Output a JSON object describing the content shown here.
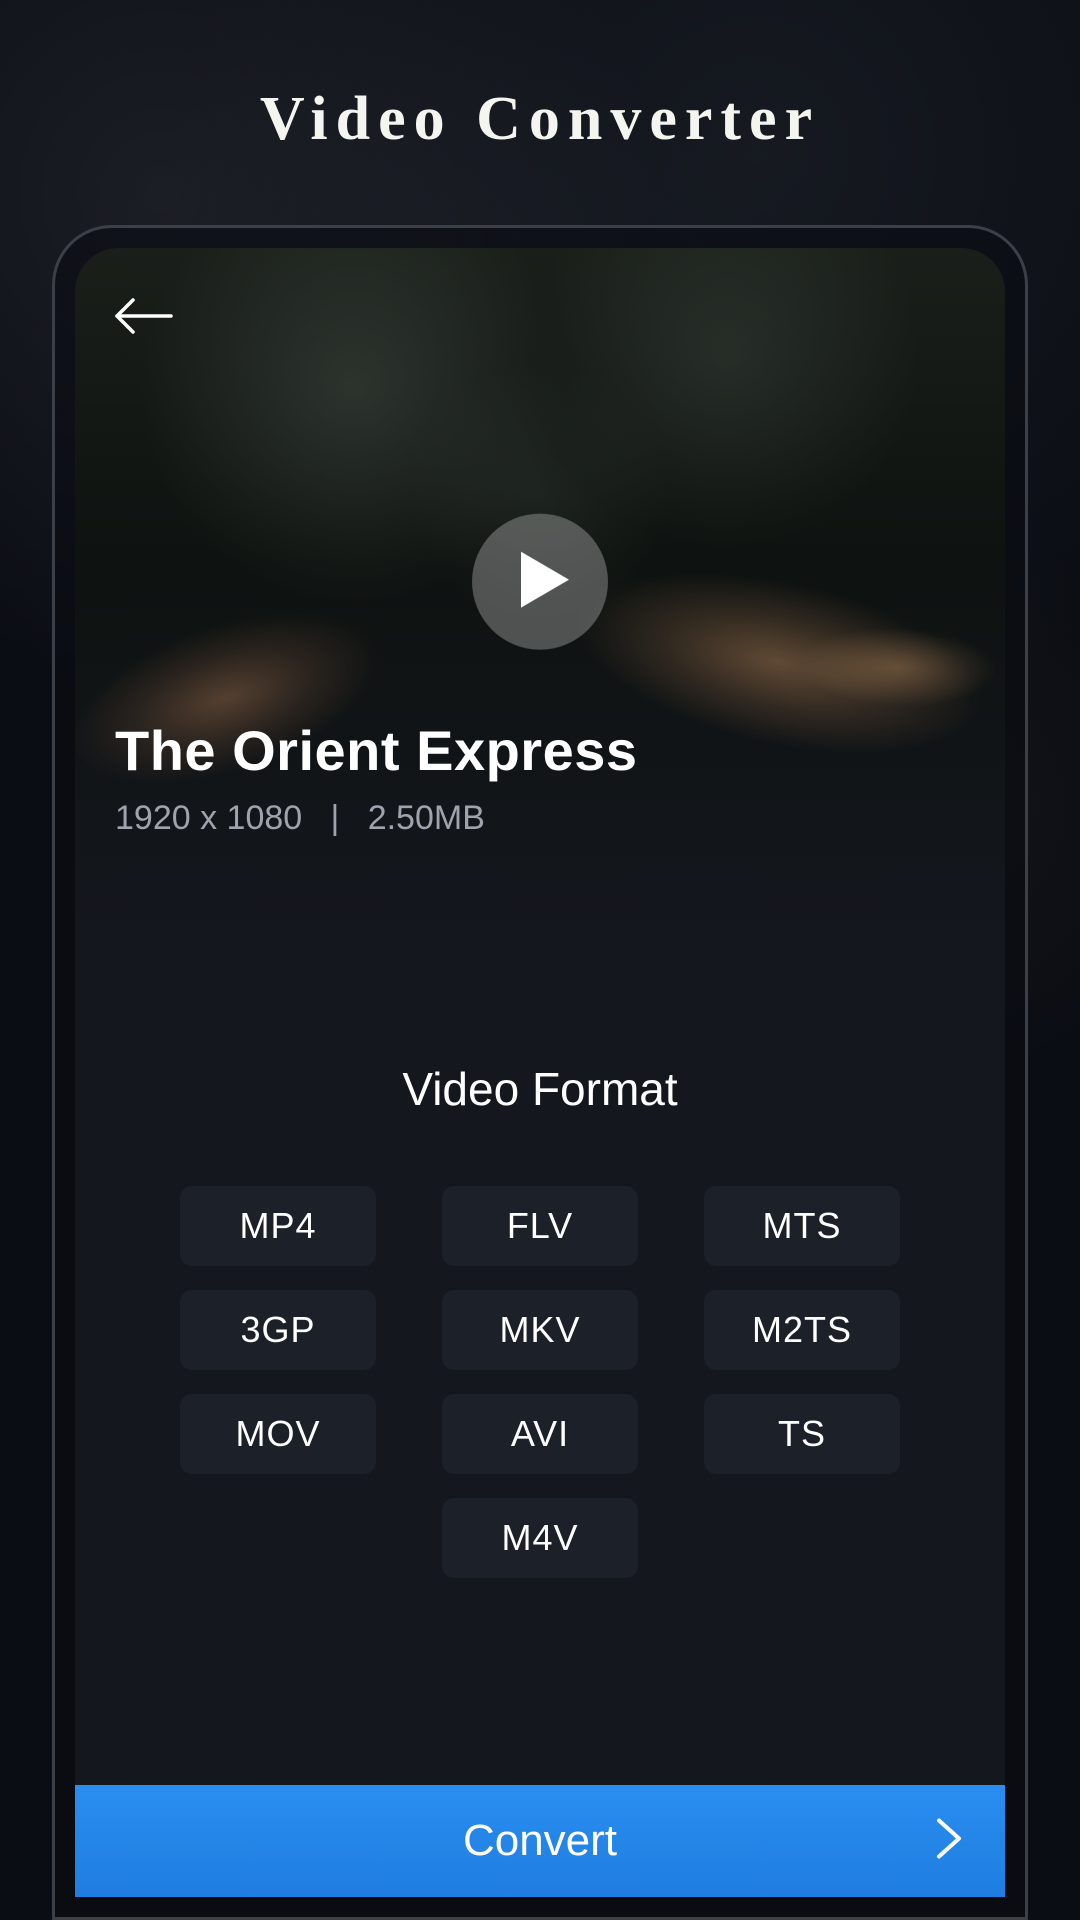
{
  "app_title": "Video Converter",
  "video": {
    "title": "The Orient Express",
    "resolution": "1920 x 1080",
    "separator": "|",
    "size": "2.50MB"
  },
  "formats": {
    "section_label": "Video Format",
    "items": [
      "MP4",
      "FLV",
      "MTS",
      "3GP",
      "MKV",
      "M2TS",
      "MOV",
      "AVI",
      "TS",
      "M4V"
    ]
  },
  "actions": {
    "convert": "Convert"
  },
  "colors": {
    "accent": "#2a8ef0",
    "chip_bg": "#1c2029",
    "screen_bg": "#14171e"
  }
}
